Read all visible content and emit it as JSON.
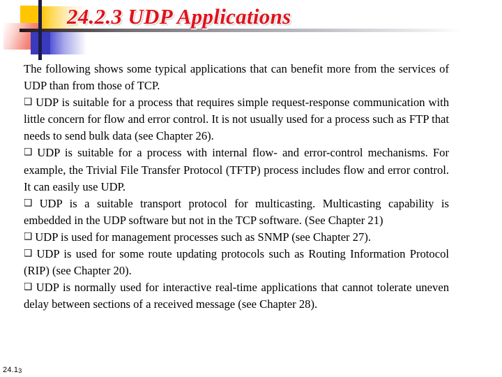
{
  "slide": {
    "title": "24.2.3  UDP Applications",
    "title_color": "#E1121C",
    "background_color": "#FFFFFF",
    "footer": {
      "prefix": "24.1",
      "suffix": "3"
    }
  },
  "decoration": {
    "yellow_square_color": "#FFC500",
    "red_square_color": "#F0564A",
    "blue_square_color": "#3A3ABE",
    "rule_color": "#231717",
    "vertical_bar_color": "#1B1B4A"
  },
  "body": {
    "intro": "The following shows some typical applications that can benefit more from the services of UDP than from those of TCP.",
    "bullet_glyph": "❑",
    "bullets": [
      "UDP is suitable for a process that requires simple request-response communication with little concern for flow and error control. It is not usually used for a process such as FTP that needs to send bulk data (see Chapter 26).",
      "UDP is suitable for a process with internal flow- and error-control mechanisms. For example, the Trivial File Transfer Protocol (TFTP) process includes flow and error control. It can easily use UDP.",
      "UDP is a suitable transport protocol for multicasting. Multicasting capability is embedded in the UDP software but not in the TCP software. (See Chapter 21)",
      "UDP is used for management processes such as SNMP (see Chapter 27).",
      "UDP is used for some route updating protocols such as Routing Information Protocol (RIP) (see Chapter 20).",
      "UDP is normally used for interactive real-time applications that cannot tolerate uneven delay between sections of a received message (see Chapter 28)."
    ]
  }
}
